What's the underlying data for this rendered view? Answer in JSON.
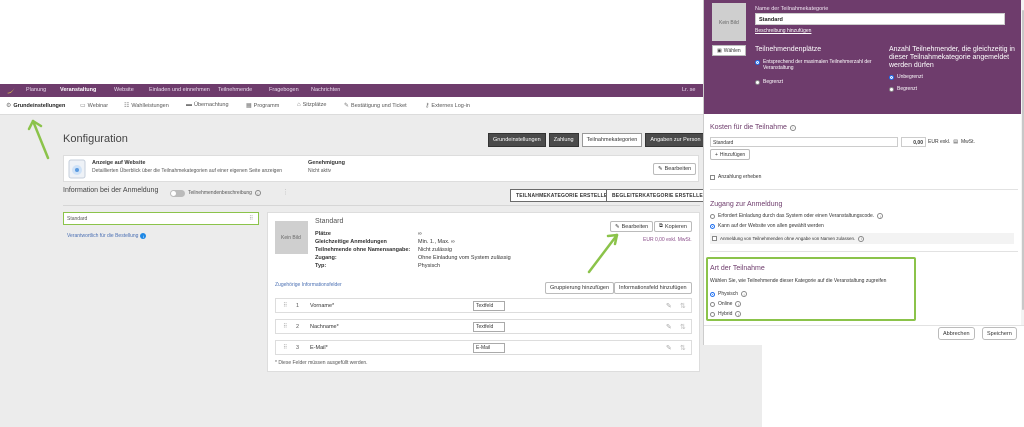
{
  "topnav": {
    "items": [
      "Planung",
      "Veranstaltung",
      "Website",
      "Einladen und einnehmen",
      "Teilnehmende",
      "Fragebogen",
      "Nachrichten"
    ],
    "right_text": "Lr. se"
  },
  "subnav": {
    "items": [
      "Grundeinstellungen",
      "Webinar",
      "Wahlleistungen",
      "Übernachtung",
      "Programm",
      "Sitzplätze",
      "Bestätigung und Ticket",
      "Externes Log-in"
    ]
  },
  "page": {
    "title": "Konfiguration",
    "tabs": [
      "Grundeinstellungen",
      "Zahlung",
      "Teilnahmekategorien",
      "Angaben zur Person"
    ]
  },
  "website_info": {
    "title": "Anzeige auf Website",
    "desc": "Detaillierten Überblick über die Teilnahmekategorien auf einer eigenen Seite anzeigen",
    "approval_label": "Genehmigung",
    "approval_value": "Nicht aktiv",
    "edit_label": "Bearbeiten"
  },
  "registration": {
    "title": "Information bei der Anmeldung",
    "toggle_label": "Teilnehmendenbeschreibung",
    "create_category": "TEILNAHMEKATEGORIE ERSTELLEN",
    "create_companion": "BEGLEITERKATEGORIE ERSTELLEN"
  },
  "sidebar": {
    "selected": "Standard",
    "responsible": "Verantwortlich für die Bestellung"
  },
  "category": {
    "image_label": "Kein Bild",
    "name": "Standard",
    "edit_label": "Bearbeiten",
    "copy_label": "Kopieren",
    "price_line": "EUR 0,00 exkl. MwSt.",
    "details": [
      {
        "label": "Plätze",
        "value": "∞"
      },
      {
        "label": "Gleichzeitige Anmeldungen",
        "value": "Min. 1., Max. ∞"
      },
      {
        "label": "Teilnehmende ohne Namensangabe:",
        "value": "Nicht zulässig"
      },
      {
        "label": "Zugang:",
        "value": "Ohne Einladung vom System zulässig"
      },
      {
        "label": "Typ:",
        "value": "Physisch"
      }
    ],
    "fields_link": "Zugehörige Informationsfelder",
    "group_button": "Gruppierung hinzufügen",
    "field_button": "Informationsfeld hinzufügen",
    "fields": [
      {
        "num": "1",
        "name": "Vorname*",
        "type": "Textfeld"
      },
      {
        "num": "2",
        "name": "Nachname*",
        "type": "Textfeld"
      },
      {
        "num": "3",
        "name": "E-Mail*",
        "type": "E-Mail"
      }
    ],
    "required_note": "* Diese Felder müssen ausgefüllt werden."
  },
  "modal": {
    "image_label": "Kein Bild",
    "choose_label": "Wählen",
    "name_label": "Name der Teilnahmekategorie",
    "name_value": "Standard",
    "add_description": "Beschreibung hinzufügen",
    "seats_title": "Teilnehmendenplätze",
    "seats_opt1": "Entsprechend der maximalen Teilnehmerzahl der Veranstaltung",
    "seats_opt2": "Begrenzt",
    "concurrent_title": "Anzahl Teilnehmender, die gleichzeitig in dieser Teilnahmekategorie angemeldet werden dürfen",
    "concurrent_opt1": "Unbegrenzt",
    "concurrent_opt2": "Begrenzt",
    "cost_title": "Kosten für die Teilnahme",
    "cost_item_name": "Standard",
    "cost_amount": "0,00",
    "cost_currency": "EUR exkl.",
    "cost_vat": "MwSt.",
    "add_label": "Hinzufügen",
    "deposit_label": "Anzahlung erheben",
    "access_title": "Zugang zur Anmeldung",
    "access_opt1": "Erfordert Einladung durch das System oder einen Veranstaltungscode.",
    "access_opt2": "Kann auf der Website von allen gewählt werden",
    "access_check": "Anmeldung von Teilnehmenden ohne Angabe von Namen zulassen.",
    "type_title": "Art der Teilnahme",
    "type_desc": "Wählen Sie, wie Teilnehmende dieser Kategorie auf die Veranstaltung zugreifen",
    "type_opt1": "Physisch",
    "type_opt2": "Online",
    "type_opt3": "Hybrid",
    "cancel_label": "Abbrechen",
    "save_label": "Speichern"
  },
  "colors": {
    "brand_purple": "#6e3c6c",
    "highlight_green": "#8bc34a",
    "radio_blue": "#1e6ff0"
  }
}
